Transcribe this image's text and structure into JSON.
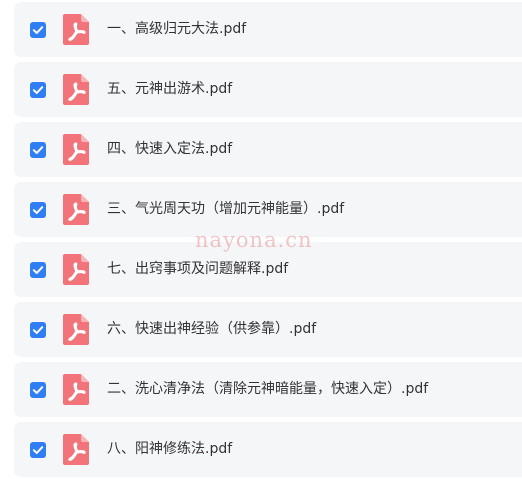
{
  "files": [
    {
      "name": "一、高级归元大法.pdf",
      "checked": true,
      "icon": "pdf-icon"
    },
    {
      "name": "五、元神出游术.pdf",
      "checked": true,
      "icon": "pdf-icon"
    },
    {
      "name": "四、快速入定法.pdf",
      "checked": true,
      "icon": "pdf-icon"
    },
    {
      "name": "三、气光周天功（增加元神能量）.pdf",
      "checked": true,
      "icon": "pdf-icon"
    },
    {
      "name": "七、出窍事项及问题解释.pdf",
      "checked": true,
      "icon": "pdf-icon"
    },
    {
      "name": "六、快速出神经验（供参靠）.pdf",
      "checked": true,
      "icon": "pdf-icon"
    },
    {
      "name": "二、洗心清净法（清除元神暗能量，快速入定）.pdf",
      "checked": true,
      "icon": "pdf-icon"
    },
    {
      "name": "八、阳神修练法.pdf",
      "checked": true,
      "icon": "pdf-icon"
    }
  ],
  "watermark": "nayona.cn",
  "colors": {
    "checkbox": "#2f7ef5",
    "pdf_icon": "#f2737a",
    "row_bg": "#f5f6f8",
    "text": "#333333"
  }
}
